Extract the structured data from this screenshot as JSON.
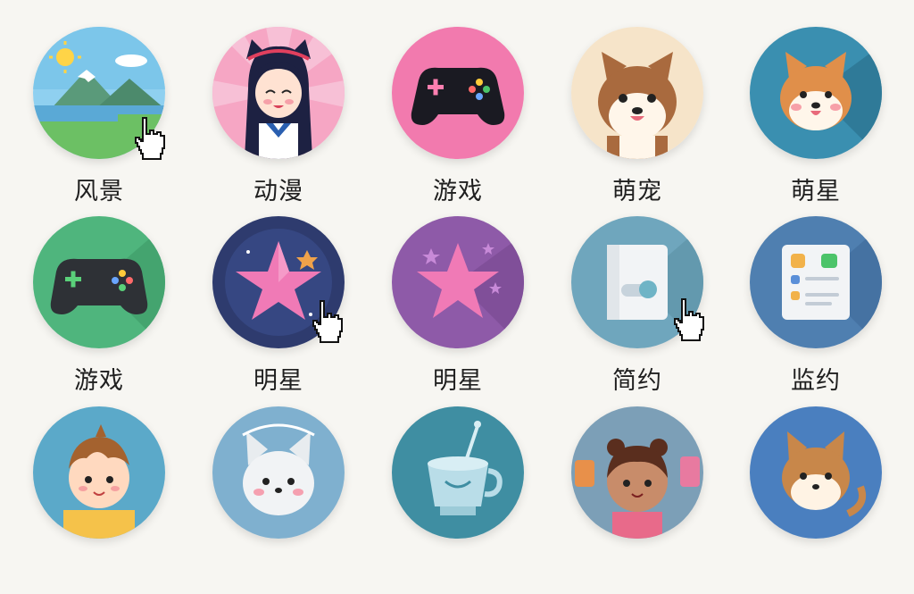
{
  "categories": [
    {
      "label": "风景",
      "icon": "landscape-icon",
      "bg": "#78c6e8"
    },
    {
      "label": "动漫",
      "icon": "anime-girl-icon",
      "bg": "#f08cb0"
    },
    {
      "label": "游戏",
      "icon": "gamepad-icon",
      "bg": "#f27aae"
    },
    {
      "label": "萌宠",
      "icon": "shiba-dog-icon",
      "bg": "#f6e4c9"
    },
    {
      "label": "萌星",
      "icon": "shiba-dog-icon",
      "bg": "#3a8fb0"
    },
    {
      "label": "游戏",
      "icon": "gamepad-icon",
      "bg": "#4fb57d"
    },
    {
      "label": "明星",
      "icon": "star-icon",
      "bg": "#2e3b6e"
    },
    {
      "label": "明星",
      "icon": "star-icon",
      "bg": "#8e5aa8"
    },
    {
      "label": "简约",
      "icon": "minimal-card-icon",
      "bg": "#6fa6bd"
    },
    {
      "label": "监约",
      "icon": "dashboard-icon",
      "bg": "#4f7fb0"
    },
    {
      "label": "",
      "icon": "boy-icon",
      "bg": "#5ba9c9"
    },
    {
      "label": "",
      "icon": "cat-icon",
      "bg": "#7fb0cf"
    },
    {
      "label": "",
      "icon": "cup-icon",
      "bg": "#3f8ea2"
    },
    {
      "label": "",
      "icon": "girl-icon",
      "bg": "#7c9fb7"
    },
    {
      "label": "",
      "icon": "cat-icon",
      "bg": "#4a7fbf"
    }
  ]
}
